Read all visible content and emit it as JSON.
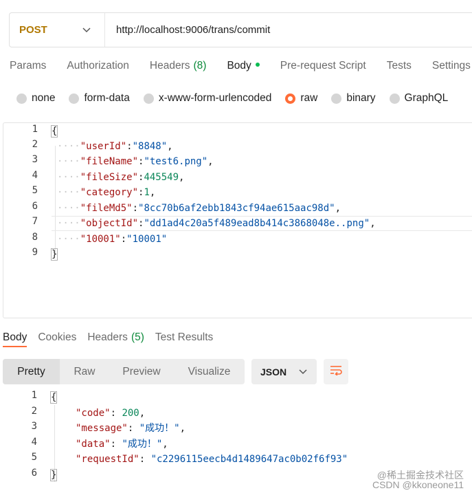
{
  "request": {
    "method": "POST",
    "url": "http://localhost:9006/trans/commit"
  },
  "request_tabs": {
    "params": "Params",
    "authorization": "Authorization",
    "headers_label": "Headers",
    "headers_count": "(8)",
    "body": "Body",
    "prerequest": "Pre-request Script",
    "tests": "Tests",
    "settings": "Settings"
  },
  "body_types": {
    "none": "none",
    "form_data": "form-data",
    "urlencoded": "x-www-form-urlencoded",
    "raw": "raw",
    "binary": "binary",
    "graphql": "GraphQL",
    "selected": "raw"
  },
  "request_body": {
    "line_numbers": [
      "1",
      "2",
      "3",
      "4",
      "5",
      "6",
      "7",
      "8",
      "9"
    ],
    "open_brace": "{",
    "close_brace": "}",
    "k_userId": "\"userId\"",
    "v_userId": "\"8848\"",
    "k_fileName": "\"fileName\"",
    "v_fileName": "\"test6.png\"",
    "k_fileSize": "\"fileSize\"",
    "v_fileSize": "445549",
    "k_category": "\"category\"",
    "v_category": "1",
    "k_fileMd5": "\"fileMd5\"",
    "v_fileMd5": "\"8cc70b6af2ebb1843cf94ae615aac98d\"",
    "k_objectId": "\"objectId\"",
    "v_objectId": "\"dd1ad4c20a5f489ead8b414c3868048e..png\"",
    "k_10001": "\"10001\"",
    "v_10001": "\"10001\""
  },
  "response_tabs": {
    "body": "Body",
    "cookies": "Cookies",
    "headers_label": "Headers",
    "headers_count": "(5)",
    "test_results": "Test Results"
  },
  "view_modes": {
    "pretty": "Pretty",
    "raw": "Raw",
    "preview": "Preview",
    "visualize": "Visualize",
    "format": "JSON"
  },
  "response_body": {
    "line_numbers": [
      "1",
      "2",
      "3",
      "4",
      "5",
      "6"
    ],
    "open_brace": "{",
    "close_brace": "}",
    "k_code": "\"code\"",
    "v_code": "200",
    "k_message": "\"message\"",
    "v_message": "\"成功！\"",
    "k_data": "\"data\"",
    "v_data": "\"成功！\"",
    "k_requestId": "\"requestId\"",
    "v_requestId": "\"c2296115eecb4d1489647ac0b02f6f93\""
  },
  "watermark": {
    "line1": "@稀土掘金技术社区",
    "line2": "CSDN @kkoneone11"
  },
  "colors": {
    "accent": "#ff6c37",
    "method_post": "#b07800",
    "json_key": "#a31515",
    "json_string": "#0451a5",
    "json_number": "#098658"
  }
}
